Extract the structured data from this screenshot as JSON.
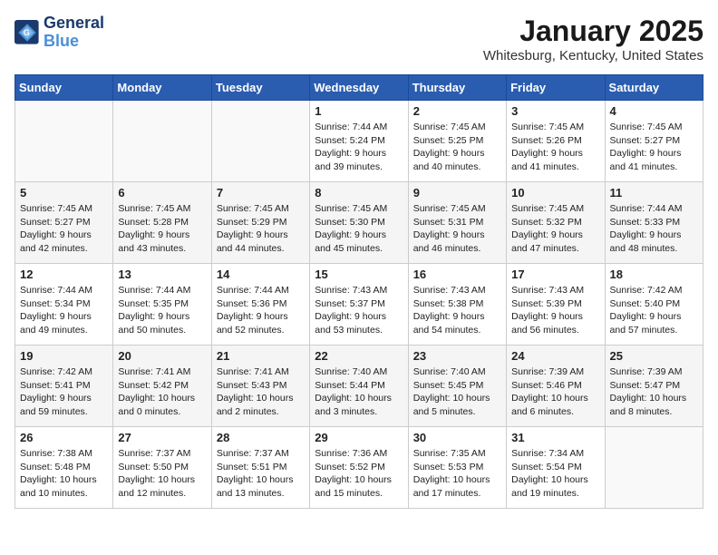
{
  "header": {
    "logo_line1": "General",
    "logo_line2": "Blue",
    "title": "January 2025",
    "subtitle": "Whitesburg, Kentucky, United States"
  },
  "weekdays": [
    "Sunday",
    "Monday",
    "Tuesday",
    "Wednesday",
    "Thursday",
    "Friday",
    "Saturday"
  ],
  "weeks": [
    [
      {
        "day": "",
        "content": ""
      },
      {
        "day": "",
        "content": ""
      },
      {
        "day": "",
        "content": ""
      },
      {
        "day": "1",
        "content": "Sunrise: 7:44 AM\nSunset: 5:24 PM\nDaylight: 9 hours and 39 minutes."
      },
      {
        "day": "2",
        "content": "Sunrise: 7:45 AM\nSunset: 5:25 PM\nDaylight: 9 hours and 40 minutes."
      },
      {
        "day": "3",
        "content": "Sunrise: 7:45 AM\nSunset: 5:26 PM\nDaylight: 9 hours and 41 minutes."
      },
      {
        "day": "4",
        "content": "Sunrise: 7:45 AM\nSunset: 5:27 PM\nDaylight: 9 hours and 41 minutes."
      }
    ],
    [
      {
        "day": "5",
        "content": "Sunrise: 7:45 AM\nSunset: 5:27 PM\nDaylight: 9 hours and 42 minutes."
      },
      {
        "day": "6",
        "content": "Sunrise: 7:45 AM\nSunset: 5:28 PM\nDaylight: 9 hours and 43 minutes."
      },
      {
        "day": "7",
        "content": "Sunrise: 7:45 AM\nSunset: 5:29 PM\nDaylight: 9 hours and 44 minutes."
      },
      {
        "day": "8",
        "content": "Sunrise: 7:45 AM\nSunset: 5:30 PM\nDaylight: 9 hours and 45 minutes."
      },
      {
        "day": "9",
        "content": "Sunrise: 7:45 AM\nSunset: 5:31 PM\nDaylight: 9 hours and 46 minutes."
      },
      {
        "day": "10",
        "content": "Sunrise: 7:45 AM\nSunset: 5:32 PM\nDaylight: 9 hours and 47 minutes."
      },
      {
        "day": "11",
        "content": "Sunrise: 7:44 AM\nSunset: 5:33 PM\nDaylight: 9 hours and 48 minutes."
      }
    ],
    [
      {
        "day": "12",
        "content": "Sunrise: 7:44 AM\nSunset: 5:34 PM\nDaylight: 9 hours and 49 minutes."
      },
      {
        "day": "13",
        "content": "Sunrise: 7:44 AM\nSunset: 5:35 PM\nDaylight: 9 hours and 50 minutes."
      },
      {
        "day": "14",
        "content": "Sunrise: 7:44 AM\nSunset: 5:36 PM\nDaylight: 9 hours and 52 minutes."
      },
      {
        "day": "15",
        "content": "Sunrise: 7:43 AM\nSunset: 5:37 PM\nDaylight: 9 hours and 53 minutes."
      },
      {
        "day": "16",
        "content": "Sunrise: 7:43 AM\nSunset: 5:38 PM\nDaylight: 9 hours and 54 minutes."
      },
      {
        "day": "17",
        "content": "Sunrise: 7:43 AM\nSunset: 5:39 PM\nDaylight: 9 hours and 56 minutes."
      },
      {
        "day": "18",
        "content": "Sunrise: 7:42 AM\nSunset: 5:40 PM\nDaylight: 9 hours and 57 minutes."
      }
    ],
    [
      {
        "day": "19",
        "content": "Sunrise: 7:42 AM\nSunset: 5:41 PM\nDaylight: 9 hours and 59 minutes."
      },
      {
        "day": "20",
        "content": "Sunrise: 7:41 AM\nSunset: 5:42 PM\nDaylight: 10 hours and 0 minutes."
      },
      {
        "day": "21",
        "content": "Sunrise: 7:41 AM\nSunset: 5:43 PM\nDaylight: 10 hours and 2 minutes."
      },
      {
        "day": "22",
        "content": "Sunrise: 7:40 AM\nSunset: 5:44 PM\nDaylight: 10 hours and 3 minutes."
      },
      {
        "day": "23",
        "content": "Sunrise: 7:40 AM\nSunset: 5:45 PM\nDaylight: 10 hours and 5 minutes."
      },
      {
        "day": "24",
        "content": "Sunrise: 7:39 AM\nSunset: 5:46 PM\nDaylight: 10 hours and 6 minutes."
      },
      {
        "day": "25",
        "content": "Sunrise: 7:39 AM\nSunset: 5:47 PM\nDaylight: 10 hours and 8 minutes."
      }
    ],
    [
      {
        "day": "26",
        "content": "Sunrise: 7:38 AM\nSunset: 5:48 PM\nDaylight: 10 hours and 10 minutes."
      },
      {
        "day": "27",
        "content": "Sunrise: 7:37 AM\nSunset: 5:50 PM\nDaylight: 10 hours and 12 minutes."
      },
      {
        "day": "28",
        "content": "Sunrise: 7:37 AM\nSunset: 5:51 PM\nDaylight: 10 hours and 13 minutes."
      },
      {
        "day": "29",
        "content": "Sunrise: 7:36 AM\nSunset: 5:52 PM\nDaylight: 10 hours and 15 minutes."
      },
      {
        "day": "30",
        "content": "Sunrise: 7:35 AM\nSunset: 5:53 PM\nDaylight: 10 hours and 17 minutes."
      },
      {
        "day": "31",
        "content": "Sunrise: 7:34 AM\nSunset: 5:54 PM\nDaylight: 10 hours and 19 minutes."
      },
      {
        "day": "",
        "content": ""
      }
    ]
  ]
}
